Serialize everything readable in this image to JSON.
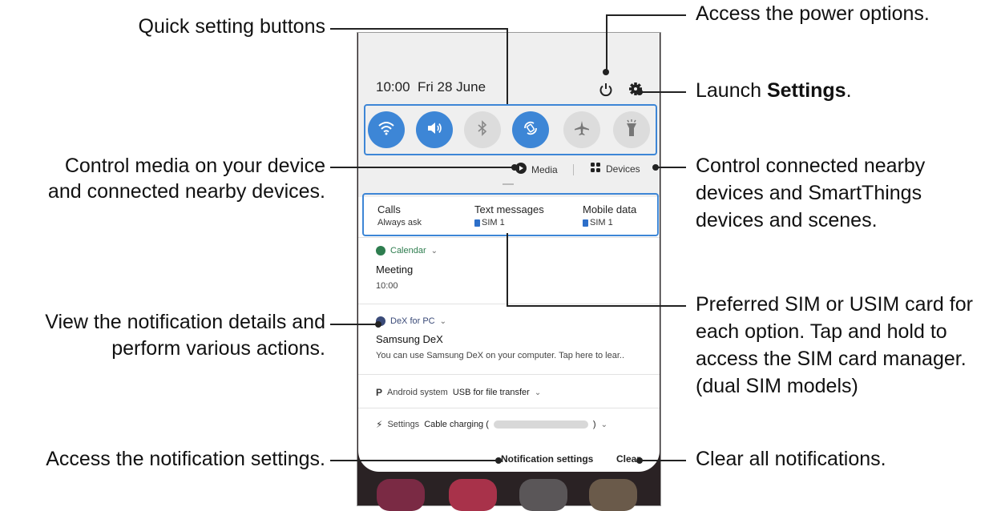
{
  "status_bar": {
    "time": "10:00",
    "date": "Fri 28 June"
  },
  "quick_settings": {
    "buttons": [
      {
        "icon": "wifi-icon",
        "state": "on"
      },
      {
        "icon": "sound-icon",
        "state": "on"
      },
      {
        "icon": "bluetooth-icon",
        "state": "off"
      },
      {
        "icon": "auto-rotate-icon",
        "state": "on"
      },
      {
        "icon": "airplane-icon",
        "state": "off"
      },
      {
        "icon": "flashlight-icon",
        "state": "off"
      }
    ],
    "media_label": "Media",
    "devices_label": "Devices"
  },
  "sim": {
    "calls_label": "Calls",
    "calls_value": "Always ask",
    "texts_label": "Text messages",
    "texts_value": "SIM 1",
    "data_label": "Mobile data",
    "data_value": "SIM 1"
  },
  "notifications": {
    "calendar": {
      "app": "Calendar",
      "title": "Meeting",
      "body": "10:00"
    },
    "dex": {
      "app": "DeX for PC",
      "title": "Samsung DeX",
      "body": "You can use Samsung DeX on your computer. Tap here to lear.."
    },
    "android": {
      "app": "Android system",
      "text": "USB for file transfer"
    },
    "settings": {
      "app": "Settings",
      "text": "Cable charging ("
    }
  },
  "footer": {
    "notification_settings": "Notification settings",
    "clear": "Clear"
  },
  "captions": {
    "quick_setting_buttons": "Quick setting buttons",
    "control_media_1": "Control media on your device",
    "control_media_2": "and connected nearby devices.",
    "view_details_1": "View the notification details and",
    "view_details_2": "perform various actions.",
    "access_notif_settings": "Access the notification settings.",
    "power_options": "Access the power options.",
    "launch_prefix": "Launch ",
    "launch_bold": "Settings",
    "launch_suffix": ".",
    "connected_1": "Control connected nearby",
    "connected_2": "devices and SmartThings",
    "connected_3": "devices and scenes.",
    "sim_1": "Preferred SIM or USIM card for",
    "sim_2": "each option. Tap and hold to",
    "sim_3": "access the SIM card manager.",
    "sim_4": "(dual SIM models)",
    "clear_all": "Clear all notifications."
  },
  "colors": {
    "accent": "#3d86d6",
    "panel_top": "#efefef",
    "wallpaper": "#2a2224"
  }
}
